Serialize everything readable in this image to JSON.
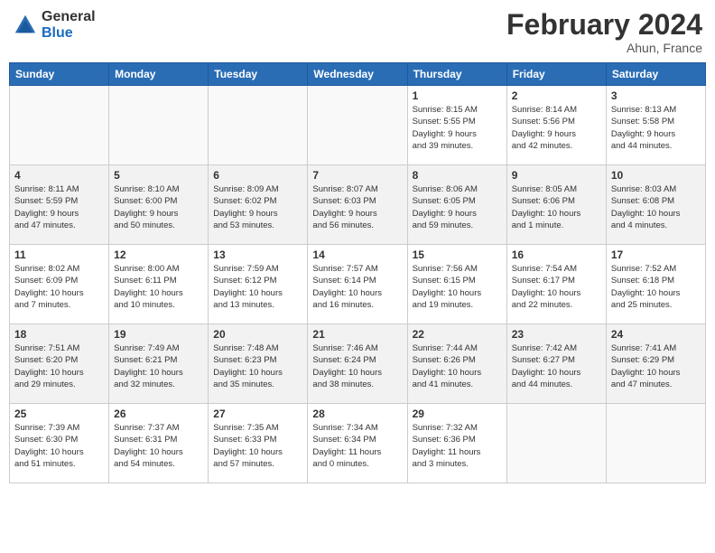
{
  "header": {
    "logo_general": "General",
    "logo_blue": "Blue",
    "month_year": "February 2024",
    "location": "Ahun, France"
  },
  "days_of_week": [
    "Sunday",
    "Monday",
    "Tuesday",
    "Wednesday",
    "Thursday",
    "Friday",
    "Saturday"
  ],
  "weeks": [
    [
      {
        "day": "",
        "info": ""
      },
      {
        "day": "",
        "info": ""
      },
      {
        "day": "",
        "info": ""
      },
      {
        "day": "",
        "info": ""
      },
      {
        "day": "1",
        "info": "Sunrise: 8:15 AM\nSunset: 5:55 PM\nDaylight: 9 hours\nand 39 minutes."
      },
      {
        "day": "2",
        "info": "Sunrise: 8:14 AM\nSunset: 5:56 PM\nDaylight: 9 hours\nand 42 minutes."
      },
      {
        "day": "3",
        "info": "Sunrise: 8:13 AM\nSunset: 5:58 PM\nDaylight: 9 hours\nand 44 minutes."
      }
    ],
    [
      {
        "day": "4",
        "info": "Sunrise: 8:11 AM\nSunset: 5:59 PM\nDaylight: 9 hours\nand 47 minutes."
      },
      {
        "day": "5",
        "info": "Sunrise: 8:10 AM\nSunset: 6:00 PM\nDaylight: 9 hours\nand 50 minutes."
      },
      {
        "day": "6",
        "info": "Sunrise: 8:09 AM\nSunset: 6:02 PM\nDaylight: 9 hours\nand 53 minutes."
      },
      {
        "day": "7",
        "info": "Sunrise: 8:07 AM\nSunset: 6:03 PM\nDaylight: 9 hours\nand 56 minutes."
      },
      {
        "day": "8",
        "info": "Sunrise: 8:06 AM\nSunset: 6:05 PM\nDaylight: 9 hours\nand 59 minutes."
      },
      {
        "day": "9",
        "info": "Sunrise: 8:05 AM\nSunset: 6:06 PM\nDaylight: 10 hours\nand 1 minute."
      },
      {
        "day": "10",
        "info": "Sunrise: 8:03 AM\nSunset: 6:08 PM\nDaylight: 10 hours\nand 4 minutes."
      }
    ],
    [
      {
        "day": "11",
        "info": "Sunrise: 8:02 AM\nSunset: 6:09 PM\nDaylight: 10 hours\nand 7 minutes."
      },
      {
        "day": "12",
        "info": "Sunrise: 8:00 AM\nSunset: 6:11 PM\nDaylight: 10 hours\nand 10 minutes."
      },
      {
        "day": "13",
        "info": "Sunrise: 7:59 AM\nSunset: 6:12 PM\nDaylight: 10 hours\nand 13 minutes."
      },
      {
        "day": "14",
        "info": "Sunrise: 7:57 AM\nSunset: 6:14 PM\nDaylight: 10 hours\nand 16 minutes."
      },
      {
        "day": "15",
        "info": "Sunrise: 7:56 AM\nSunset: 6:15 PM\nDaylight: 10 hours\nand 19 minutes."
      },
      {
        "day": "16",
        "info": "Sunrise: 7:54 AM\nSunset: 6:17 PM\nDaylight: 10 hours\nand 22 minutes."
      },
      {
        "day": "17",
        "info": "Sunrise: 7:52 AM\nSunset: 6:18 PM\nDaylight: 10 hours\nand 25 minutes."
      }
    ],
    [
      {
        "day": "18",
        "info": "Sunrise: 7:51 AM\nSunset: 6:20 PM\nDaylight: 10 hours\nand 29 minutes."
      },
      {
        "day": "19",
        "info": "Sunrise: 7:49 AM\nSunset: 6:21 PM\nDaylight: 10 hours\nand 32 minutes."
      },
      {
        "day": "20",
        "info": "Sunrise: 7:48 AM\nSunset: 6:23 PM\nDaylight: 10 hours\nand 35 minutes."
      },
      {
        "day": "21",
        "info": "Sunrise: 7:46 AM\nSunset: 6:24 PM\nDaylight: 10 hours\nand 38 minutes."
      },
      {
        "day": "22",
        "info": "Sunrise: 7:44 AM\nSunset: 6:26 PM\nDaylight: 10 hours\nand 41 minutes."
      },
      {
        "day": "23",
        "info": "Sunrise: 7:42 AM\nSunset: 6:27 PM\nDaylight: 10 hours\nand 44 minutes."
      },
      {
        "day": "24",
        "info": "Sunrise: 7:41 AM\nSunset: 6:29 PM\nDaylight: 10 hours\nand 47 minutes."
      }
    ],
    [
      {
        "day": "25",
        "info": "Sunrise: 7:39 AM\nSunset: 6:30 PM\nDaylight: 10 hours\nand 51 minutes."
      },
      {
        "day": "26",
        "info": "Sunrise: 7:37 AM\nSunset: 6:31 PM\nDaylight: 10 hours\nand 54 minutes."
      },
      {
        "day": "27",
        "info": "Sunrise: 7:35 AM\nSunset: 6:33 PM\nDaylight: 10 hours\nand 57 minutes."
      },
      {
        "day": "28",
        "info": "Sunrise: 7:34 AM\nSunset: 6:34 PM\nDaylight: 11 hours\nand 0 minutes."
      },
      {
        "day": "29",
        "info": "Sunrise: 7:32 AM\nSunset: 6:36 PM\nDaylight: 11 hours\nand 3 minutes."
      },
      {
        "day": "",
        "info": ""
      },
      {
        "day": "",
        "info": ""
      }
    ]
  ]
}
